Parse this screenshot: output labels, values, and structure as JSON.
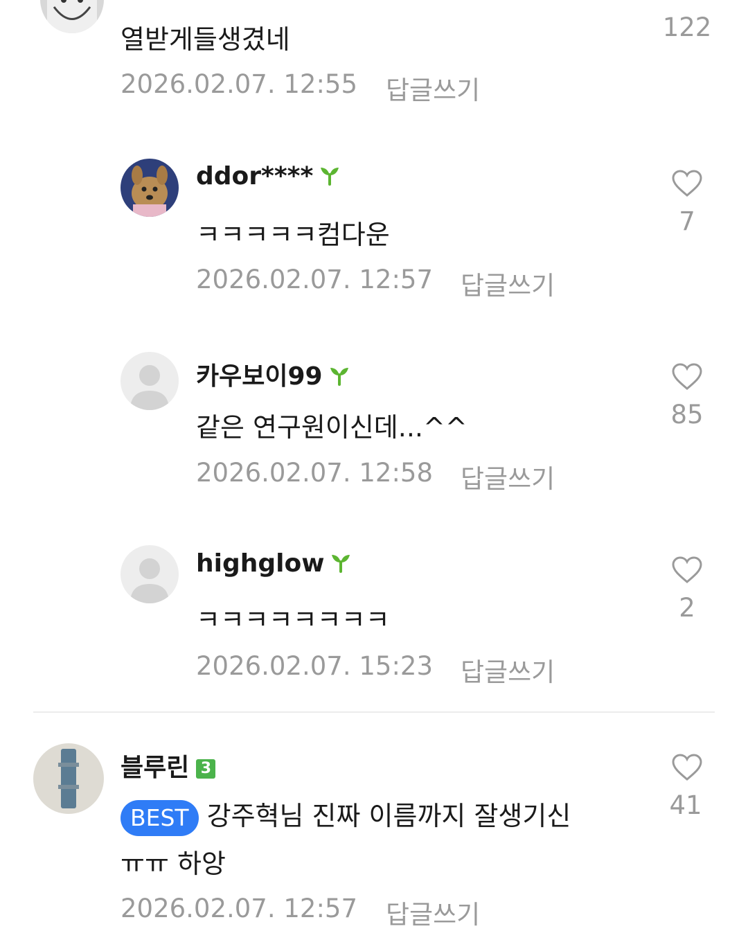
{
  "comments": [
    {
      "text": "열받게들생겼네",
      "date": "2026.02.07. 12:55",
      "reply_label": "답글쓰기",
      "likes": "122"
    },
    {
      "username": "ddor****",
      "text": "ㅋㅋㅋㅋㅋ컴다운",
      "date": "2026.02.07. 12:57",
      "reply_label": "답글쓰기",
      "likes": "7"
    },
    {
      "username": "카우보이99",
      "text": "같은 연구원이신데...^^",
      "date": "2026.02.07. 12:58",
      "reply_label": "답글쓰기",
      "likes": "85"
    },
    {
      "username": "highglow",
      "text": "ㅋㅋㅋㅋㅋㅋㅋㅋ",
      "date": "2026.02.07. 15:23",
      "reply_label": "답글쓰기",
      "likes": "2"
    },
    {
      "username": "블루린",
      "level": "3",
      "badge": "BEST",
      "text_line1": "강주혁님 진짜 이름까지 잘생기신",
      "text_line2": "ㅠㅠ 하앙",
      "date": "2026.02.07. 12:57",
      "reply_label": "답글쓰기",
      "likes": "41"
    }
  ],
  "icons": {
    "heart": "heart-outline-icon",
    "sprout": "sprout-icon",
    "default_avatar": "default-avatar-icon"
  },
  "colors": {
    "best_badge": "#2f7cf6",
    "sprout": "#5cb531",
    "meta_text": "#9a9a9a",
    "level_badge": "#4bb34b"
  }
}
